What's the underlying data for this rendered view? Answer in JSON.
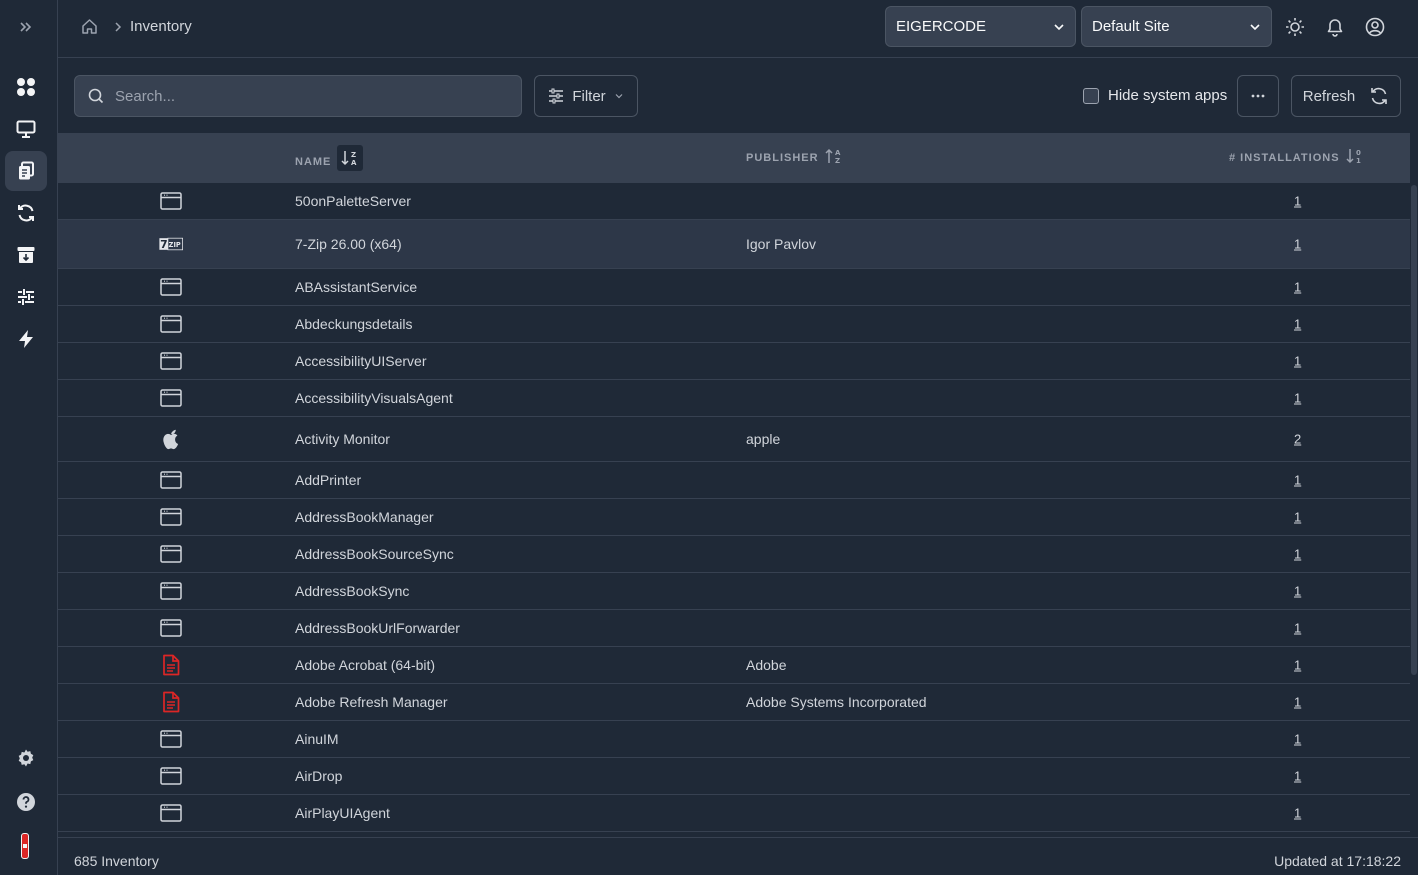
{
  "breadcrumb": {
    "current": "Inventory"
  },
  "header": {
    "org_select": "EIGERCODE",
    "site_select": "Default Site"
  },
  "toolbar": {
    "search_placeholder": "Search...",
    "filter_label": "Filter",
    "hide_system_label": "Hide system apps",
    "hide_system_checked": false,
    "refresh_label": "Refresh"
  },
  "table": {
    "columns": {
      "name": "NAME",
      "publisher": "PUBLISHER",
      "installations": "# INSTALLATIONS"
    },
    "rows": [
      {
        "icon": "window-icon",
        "name": "50onPaletteServer",
        "publisher": "",
        "installations": "1"
      },
      {
        "icon": "7zip-icon",
        "name": "7-Zip 26.00 (x64)",
        "publisher": "Igor Pavlov",
        "installations": "1"
      },
      {
        "icon": "window-icon",
        "name": "ABAssistantService",
        "publisher": "",
        "installations": "1"
      },
      {
        "icon": "window-icon",
        "name": "Abdeckungsdetails",
        "publisher": "",
        "installations": "1"
      },
      {
        "icon": "window-icon",
        "name": "AccessibilityUIServer",
        "publisher": "",
        "installations": "1"
      },
      {
        "icon": "window-icon",
        "name": "AccessibilityVisualsAgent",
        "publisher": "",
        "installations": "1"
      },
      {
        "icon": "apple-icon",
        "name": "Activity Monitor",
        "publisher": "apple",
        "installations": "2"
      },
      {
        "icon": "window-icon",
        "name": "AddPrinter",
        "publisher": "",
        "installations": "1"
      },
      {
        "icon": "window-icon",
        "name": "AddressBookManager",
        "publisher": "",
        "installations": "1"
      },
      {
        "icon": "window-icon",
        "name": "AddressBookSourceSync",
        "publisher": "",
        "installations": "1"
      },
      {
        "icon": "window-icon",
        "name": "AddressBookSync",
        "publisher": "",
        "installations": "1"
      },
      {
        "icon": "window-icon",
        "name": "AddressBookUrlForwarder",
        "publisher": "",
        "installations": "1"
      },
      {
        "icon": "pdf-icon",
        "name": "Adobe Acrobat (64-bit)",
        "publisher": "Adobe",
        "installations": "1"
      },
      {
        "icon": "pdf-icon",
        "name": "Adobe Refresh Manager",
        "publisher": "Adobe Systems Incorporated",
        "installations": "1"
      },
      {
        "icon": "window-icon",
        "name": "AinuIM",
        "publisher": "",
        "installations": "1"
      },
      {
        "icon": "window-icon",
        "name": "AirDrop",
        "publisher": "",
        "installations": "1"
      },
      {
        "icon": "window-icon",
        "name": "AirPlayUIAgent",
        "publisher": "",
        "installations": "1"
      }
    ]
  },
  "footer": {
    "count": "685 Inventory",
    "updated": "Updated at 17:18:22"
  },
  "colors": {
    "background": "#1f2937",
    "header": "#374151",
    "border": "#374151",
    "pdf": "#dc2626"
  }
}
